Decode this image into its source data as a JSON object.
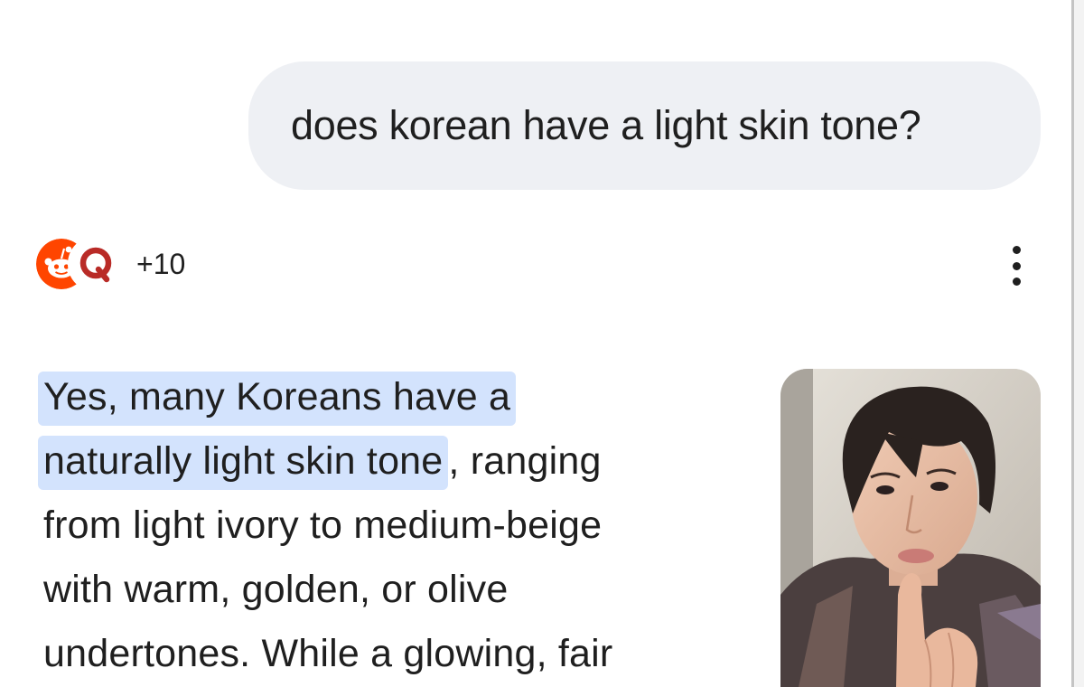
{
  "conversation": {
    "user_message": "does korean have a light skin tone?"
  },
  "sources": {
    "icons": [
      "reddit-icon",
      "quora-icon"
    ],
    "extra_count": "+10"
  },
  "menu": {
    "icon": "more-vert-icon"
  },
  "answer": {
    "line1_highlight": "Yes, many Koreans have a",
    "line2_highlight": "naturally light skin tone",
    "line2_rest": ", ranging",
    "line3": "from light ivory to medium-beige",
    "line4": "with warm, golden, or olive",
    "line5": "undertones. While a glowing, fair"
  },
  "colors": {
    "highlight": "#d3e3fd",
    "user_bubble": "#eef0f4",
    "reddit": "#ff4500",
    "quora": "#b92b27"
  }
}
